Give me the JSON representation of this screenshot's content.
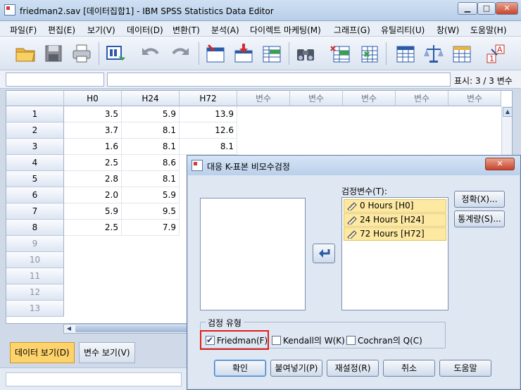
{
  "window": {
    "title": "friedman2.sav [데이터집합1] - IBM SPSS Statistics Data Editor"
  },
  "menu": [
    "파일(F)",
    "편집(E)",
    "보기(V)",
    "데이터(D)",
    "변환(T)",
    "분석(A)",
    "다이렉트 마케팅(M)",
    "그래프(G)",
    "유틸리티(U)",
    "창(W)",
    "도움말(H)"
  ],
  "toolbar": {
    "icons": [
      "open-folder-icon",
      "save-icon",
      "print-icon",
      "dialog-recall-icon",
      "undo-icon",
      "redo-icon",
      "goto-case-icon",
      "goto-variable-icon",
      "variables-icon",
      "find-icon",
      "insert-cases-icon",
      "insert-variable-icon",
      "split-file-icon",
      "weight-cases-icon",
      "select-cases-icon",
      "value-labels-icon"
    ]
  },
  "cellbar": {
    "display": "표시: 3 / 3 변수"
  },
  "grid": {
    "columns": [
      "H0",
      "H24",
      "H72",
      "변수",
      "변수",
      "변수",
      "변수",
      "변수"
    ],
    "rows": [
      {
        "n": "1",
        "v": [
          "3.5",
          "5.9",
          "13.9"
        ]
      },
      {
        "n": "2",
        "v": [
          "3.7",
          "8.1",
          "12.6"
        ]
      },
      {
        "n": "3",
        "v": [
          "1.6",
          "8.1",
          "8.1"
        ]
      },
      {
        "n": "4",
        "v": [
          "2.5",
          "8.6",
          ""
        ]
      },
      {
        "n": "5",
        "v": [
          "2.8",
          "8.1",
          ""
        ]
      },
      {
        "n": "6",
        "v": [
          "2.0",
          "5.9",
          ""
        ]
      },
      {
        "n": "7",
        "v": [
          "5.9",
          "9.5",
          ""
        ]
      },
      {
        "n": "8",
        "v": [
          "2.5",
          "7.9",
          ""
        ]
      },
      {
        "n": "9",
        "v": [
          "",
          "",
          ""
        ]
      },
      {
        "n": "10",
        "v": [
          "",
          "",
          ""
        ]
      },
      {
        "n": "11",
        "v": [
          "",
          "",
          ""
        ]
      },
      {
        "n": "12",
        "v": [
          "",
          "",
          ""
        ]
      },
      {
        "n": "13",
        "v": [
          "",
          "",
          ""
        ]
      }
    ]
  },
  "tabs": {
    "data_view": "데이터 보기(D)",
    "variable_view": "변수 보기(V)"
  },
  "dialog": {
    "title": "대응 K-표본 비모수검정",
    "test_var_label": "검정변수(T):",
    "test_vars": [
      "0 Hours [H0]",
      "24 Hours [H24]",
      "72 Hours [H72]"
    ],
    "side_buttons": [
      "정확(X)...",
      "통계량(S)..."
    ],
    "test_type_label": "검정 유형",
    "checks": [
      {
        "label": "Friedman(F)",
        "checked": true
      },
      {
        "label": "Kendall의 W(K)",
        "checked": false
      },
      {
        "label": "Cochran의 Q(C)",
        "checked": false
      }
    ],
    "buttons": [
      "확인",
      "붙여넣기(P)",
      "재설정(R)",
      "취소",
      "도움말"
    ]
  }
}
